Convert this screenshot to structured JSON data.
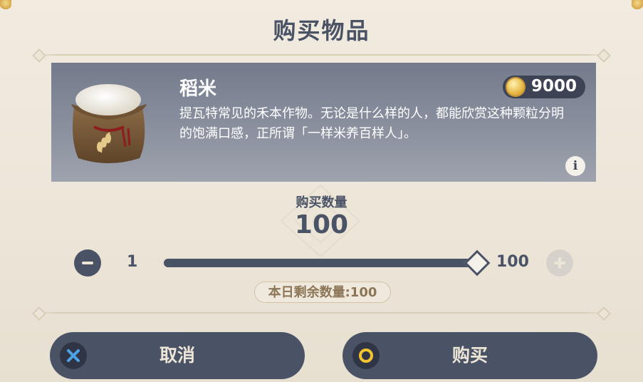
{
  "dialog": {
    "title": "购买物品"
  },
  "item": {
    "name": "稻米",
    "description": "提瓦特常见的禾本作物。无论是什么样的人，都能欣赏这种颗粒分明的饱满口感，正所谓「一样米养百样人」。",
    "price": "9000",
    "icon": "rice-sack-icon",
    "currency_icon": "mora-coin-icon",
    "info_icon": "info-icon",
    "info_glyph": "i"
  },
  "quantity": {
    "label": "购买数量",
    "value": "100",
    "min": "1",
    "max": "100",
    "slider_fraction": 1.0
  },
  "remaining": {
    "text": "本日剩余数量:100"
  },
  "buttons": {
    "cancel_label": "取消",
    "cancel_icon": "cross-button-icon",
    "buy_label": "购买",
    "buy_icon": "circle-button-icon"
  },
  "colors": {
    "panel_bg": "#ece5d8",
    "primary": "#4a5366",
    "card_top": "#737b8c",
    "cancel_accent": "#4ca3e8",
    "buy_accent": "#f4c430",
    "remaining_text": "#8c7556"
  }
}
